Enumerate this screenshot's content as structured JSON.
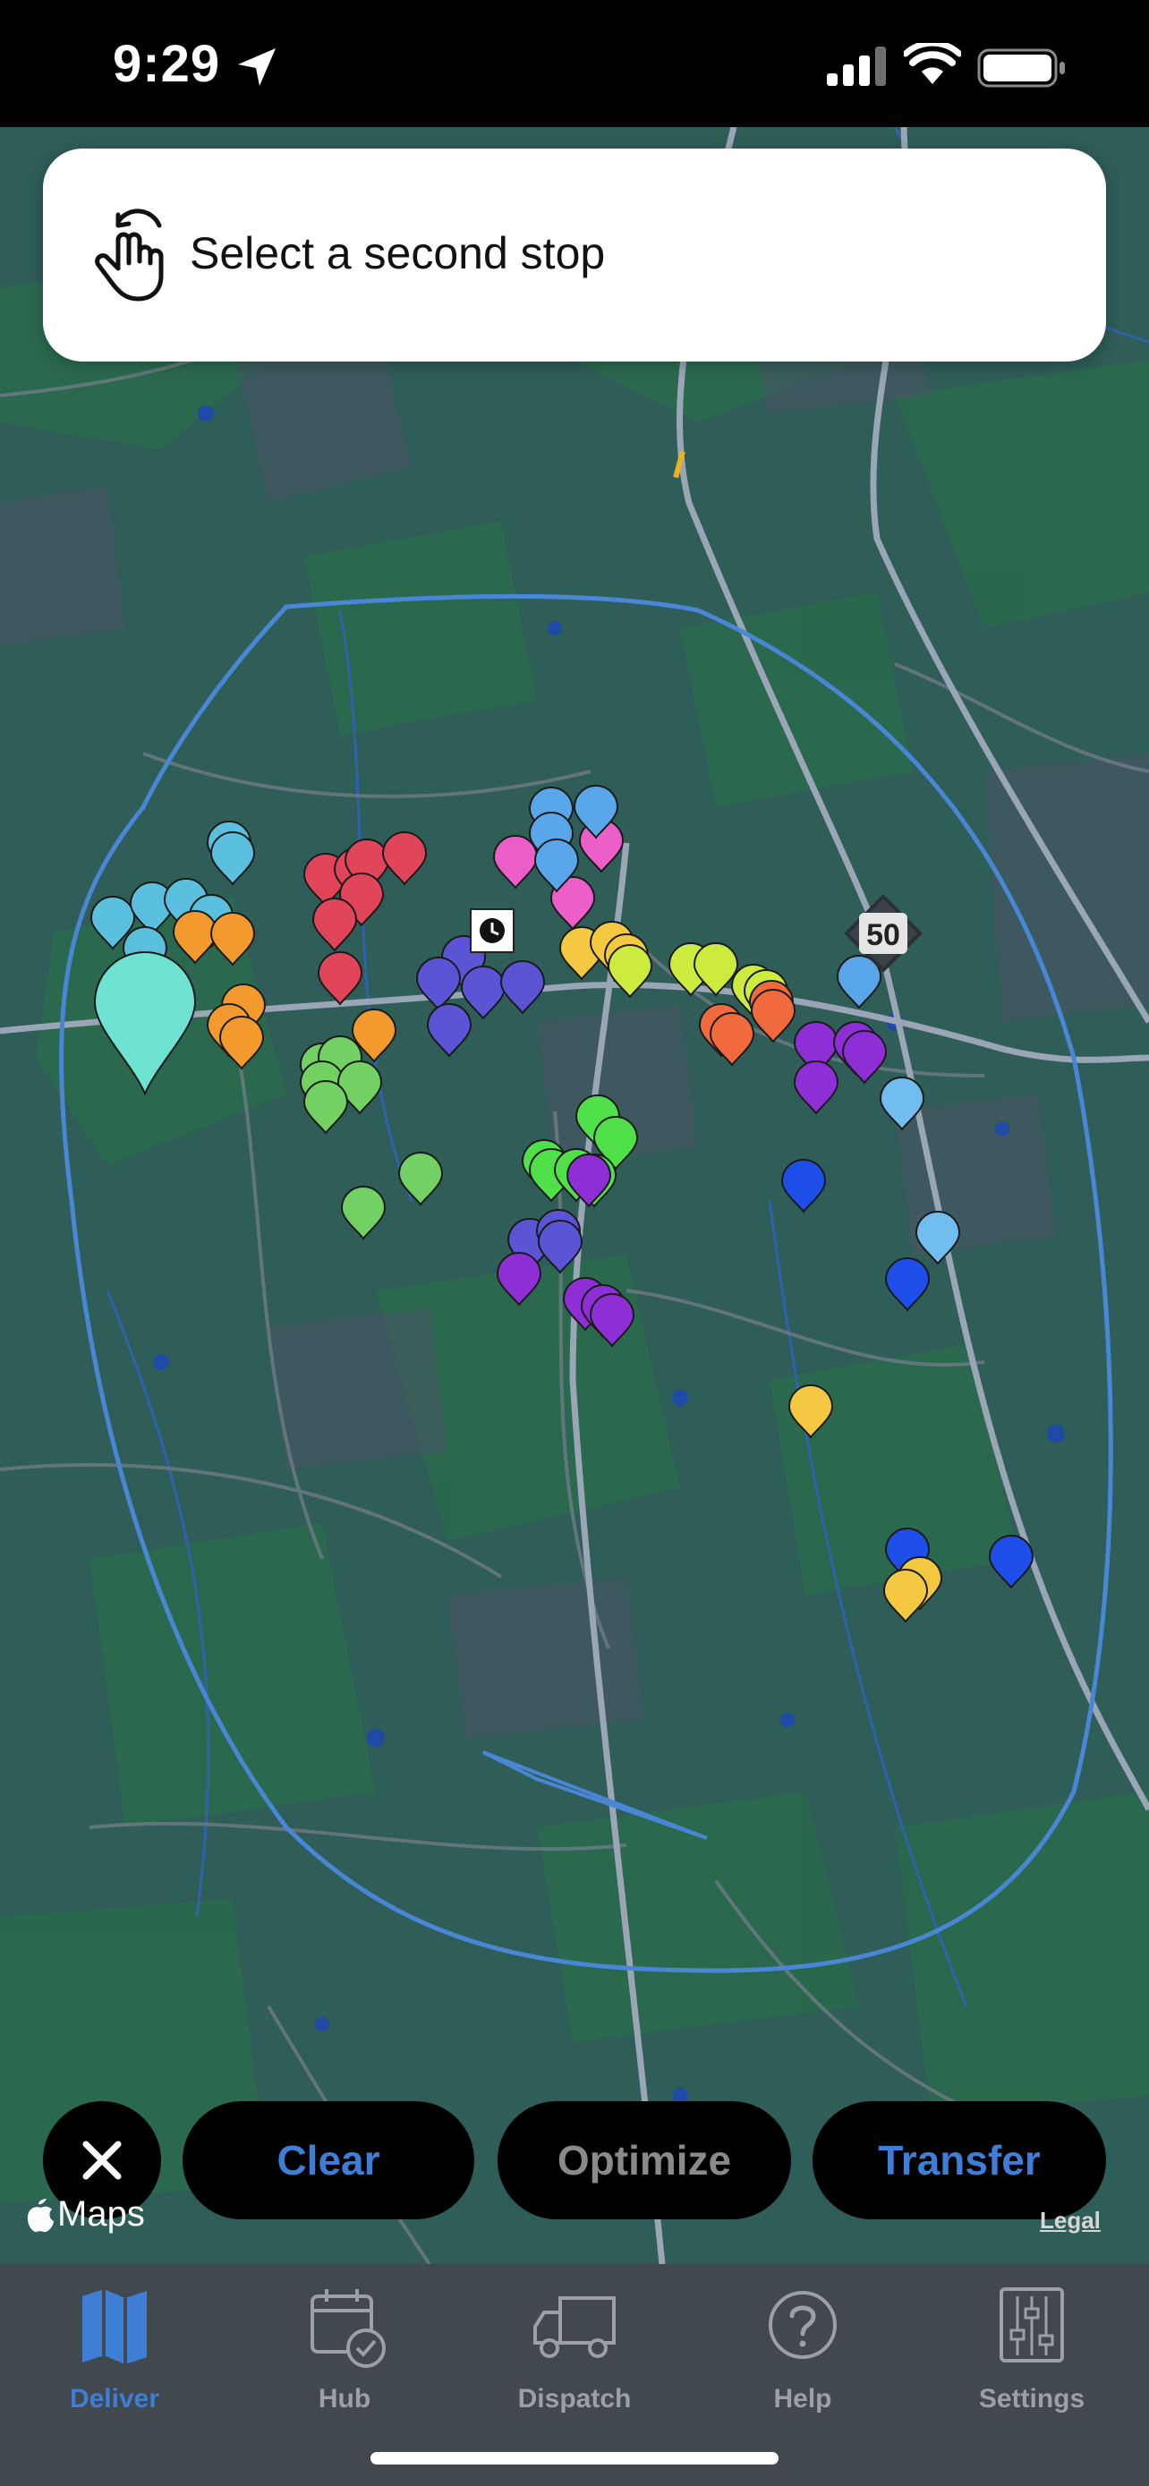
{
  "status_bar": {
    "time": "9:29"
  },
  "banner": {
    "text": "Select a second stop",
    "icon": "hand-tap-icon"
  },
  "map": {
    "road_shield": "50",
    "attribution": "Maps",
    "legal": "Legal"
  },
  "actions": {
    "close_icon": "close-icon",
    "clear": "Clear",
    "optimize": "Optimize",
    "transfer": "Transfer"
  },
  "tabs": [
    {
      "label": "Deliver",
      "icon": "map-icon",
      "active": true
    },
    {
      "label": "Hub",
      "icon": "calendar-check-icon",
      "active": false
    },
    {
      "label": "Dispatch",
      "icon": "truck-icon",
      "active": false
    },
    {
      "label": "Help",
      "icon": "help-icon",
      "active": false
    },
    {
      "label": "Settings",
      "icon": "sliders-icon",
      "active": false
    }
  ],
  "colors": {
    "accent": "#3f7ed6",
    "map_bg": "#2f5d57",
    "tab_bar_bg": "#41494e"
  }
}
